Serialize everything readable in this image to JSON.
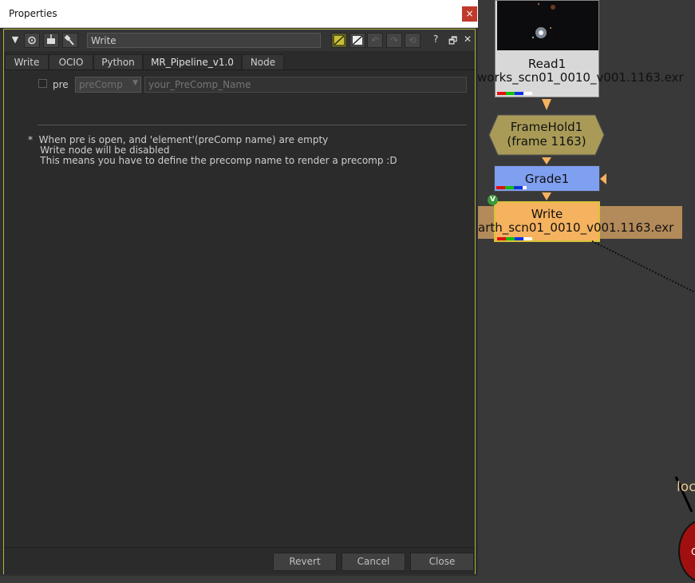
{
  "window": {
    "title": "Properties",
    "close_label": "×"
  },
  "panel": {
    "node_name": "Write",
    "help_label": "?",
    "float_label": "🗗",
    "close_label": "✕",
    "tabs": [
      {
        "label": "Write",
        "active": false
      },
      {
        "label": "OCIO",
        "active": false
      },
      {
        "label": "Python",
        "active": false
      },
      {
        "label": "MR_Pipeline_v1.0",
        "active": true
      },
      {
        "label": "Node",
        "active": false
      }
    ],
    "pre": {
      "label": "pre",
      "checked": false,
      "select_value": "preComp",
      "name_placeholder": "your_PreComp_Name"
    },
    "note": "*  When pre is open, and 'element'(preComp name) are empty\n    Write node will be disabled\n    This means you have to define the precomp name to render a precomp :D",
    "buttons": {
      "revert": "Revert",
      "cancel": "Cancel",
      "close": "Close"
    }
  },
  "graph": {
    "read": {
      "title": "Read1",
      "file": "works_scn01_0010_v001.1163.exr"
    },
    "framehold": {
      "line1": "FrameHold1",
      "line2": "(frame 1163)"
    },
    "grade": {
      "title": "Grade1"
    },
    "write": {
      "title": "Write",
      "file": "arth_scn01_0010_v001.1163.exr",
      "badge": "V"
    },
    "partial_label": "loc",
    "partial_node_text": "C",
    "colors": {
      "read": "#d8d8d8",
      "framehold": "#a99b57",
      "grade": "#7f9ff0",
      "write": "#f5b25f",
      "backdrop": "#b38a59",
      "link": "#f5b25f",
      "accent": "#b3b33a"
    }
  }
}
